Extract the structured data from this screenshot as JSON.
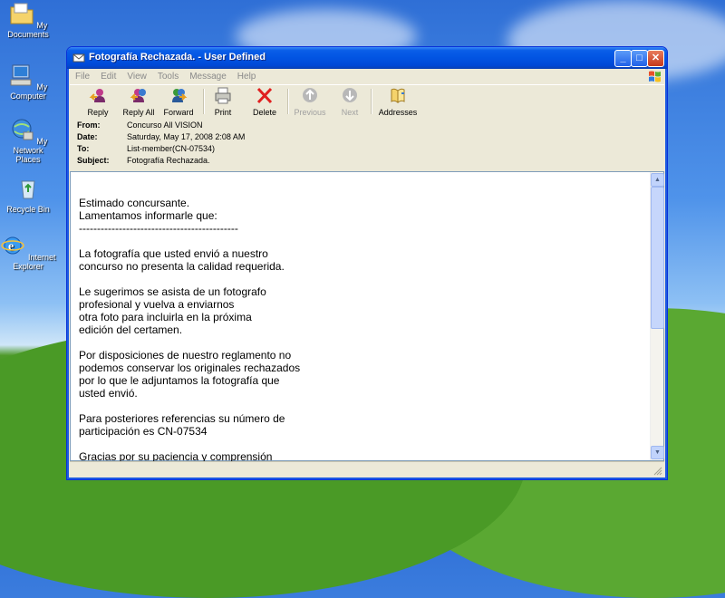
{
  "desktop": {
    "icons": [
      {
        "label": "My Documents",
        "icon": "folder-icon"
      },
      {
        "label": "My Computer",
        "icon": "computer-icon"
      },
      {
        "label": "My Network Places",
        "icon": "network-icon"
      },
      {
        "label": "Recycle Bin",
        "icon": "recycle-bin-icon"
      },
      {
        "label": "Internet Explorer",
        "icon": "internet-explorer-icon"
      }
    ]
  },
  "window": {
    "title": "Fotografía Rechazada. - User Defined",
    "menu": [
      "File",
      "Edit",
      "View",
      "Tools",
      "Message",
      "Help"
    ],
    "toolbar": {
      "reply": "Reply",
      "reply_all": "Reply All",
      "forward": "Forward",
      "print": "Print",
      "delete": "Delete",
      "previous": "Previous",
      "next": "Next",
      "addresses": "Addresses"
    },
    "header": {
      "from_label": "From:",
      "from_value": "Concurso All VISION",
      "date_label": "Date:",
      "date_value": "Saturday, May 17, 2008 2:08 AM",
      "to_label": "To:",
      "to_value": "List-member(CN-07534)",
      "subject_label": "Subject:",
      "subject_value": "Fotografía Rechazada."
    },
    "body_lines": [
      "Estimado concursante.",
      "Lamentamos informarle que:",
      "--------------------------------------------",
      "",
      "La fotografía que usted envió a nuestro",
      "concurso no presenta la calidad requerida.",
      "",
      "Le sugerimos se asista de un fotografo",
      "profesional y vuelva a enviarnos",
      "otra foto para incluirla en la próxima",
      "edición del certamen.",
      "",
      "Por disposiciones de nuestro reglamento no",
      "podemos conservar los originales rechazados",
      "por lo que le adjuntamos la fotografía que",
      "usted envió.",
      "",
      "Para posteriores referencias su número de",
      "participación es CN-07534",
      "",
      "Gracias por su paciencia y comprensión"
    ]
  },
  "colors": {
    "titlebar": "#0254e2",
    "window_bg": "#ece9d8",
    "close_button": "#c4391c"
  }
}
